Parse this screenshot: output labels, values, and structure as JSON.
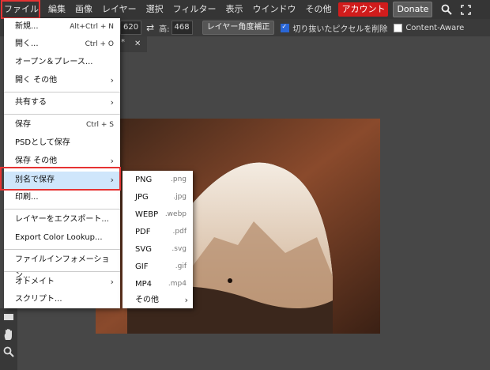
{
  "menubar": {
    "items": [
      "ファイル",
      "編集",
      "画像",
      "レイヤー",
      "選択",
      "フィルター",
      "表示",
      "ウインドウ",
      "その他"
    ],
    "account_label": "アカウント",
    "donate_label": "Donate",
    "icons": [
      "search-icon",
      "fullscreen-icon"
    ]
  },
  "options": {
    "width_value": "620",
    "height_label": "高:",
    "height_value": "468",
    "swap_icon": "⇄",
    "layer_angle_button": "レイヤー角度補正",
    "delete_cut_pixels": {
      "label": "切り抜いたピクセルを削除",
      "checked": true
    },
    "content_aware": {
      "label": "Content-Aware",
      "checked": false
    }
  },
  "doc_tab": {
    "star": "*",
    "close": "✕"
  },
  "file_menu": {
    "items": [
      {
        "label": "新規...",
        "shortcut": "Alt+Ctrl + N"
      },
      {
        "label": "開く...",
        "shortcut": "Ctrl + O"
      },
      {
        "label": "オープン＆プレース..."
      },
      {
        "label": "開く その他",
        "submenu": true
      },
      {
        "label": "共有する",
        "submenu": true
      },
      {
        "label": "保存",
        "shortcut": "Ctrl + S"
      },
      {
        "label": "PSDとして保存"
      },
      {
        "label": "保存 その他",
        "submenu": true
      },
      {
        "label": "別名で保存",
        "submenu": true,
        "selected": true
      },
      {
        "label": "印刷..."
      },
      {
        "label": "レイヤーをエクスポート..."
      },
      {
        "label": "Export Color Lookup..."
      },
      {
        "label": "ファイルインフォメーション..."
      },
      {
        "label": "オトメイト",
        "submenu": true
      },
      {
        "label": "スクリプト..."
      }
    ]
  },
  "save_as_submenu": {
    "items": [
      {
        "label": "PNG",
        "ext": ".png"
      },
      {
        "label": "JPG",
        "ext": ".jpg"
      },
      {
        "label": "WEBP",
        "ext": ".webp"
      },
      {
        "label": "PDF",
        "ext": ".pdf"
      },
      {
        "label": "SVG",
        "ext": ".svg"
      },
      {
        "label": "GIF",
        "ext": ".gif"
      },
      {
        "label": "MP4",
        "ext": ".mp4"
      },
      {
        "label": "その他",
        "submenu": true
      }
    ]
  },
  "tools": [
    "rectangle-tool-icon",
    "hand-tool-icon",
    "zoom-tool-icon"
  ],
  "colors": {
    "menubar": "#353535",
    "menu_bg": "#ffffff",
    "selected_row": "#cfe6fb",
    "highlight_box": "#e63333",
    "account": "#d11c1c"
  }
}
